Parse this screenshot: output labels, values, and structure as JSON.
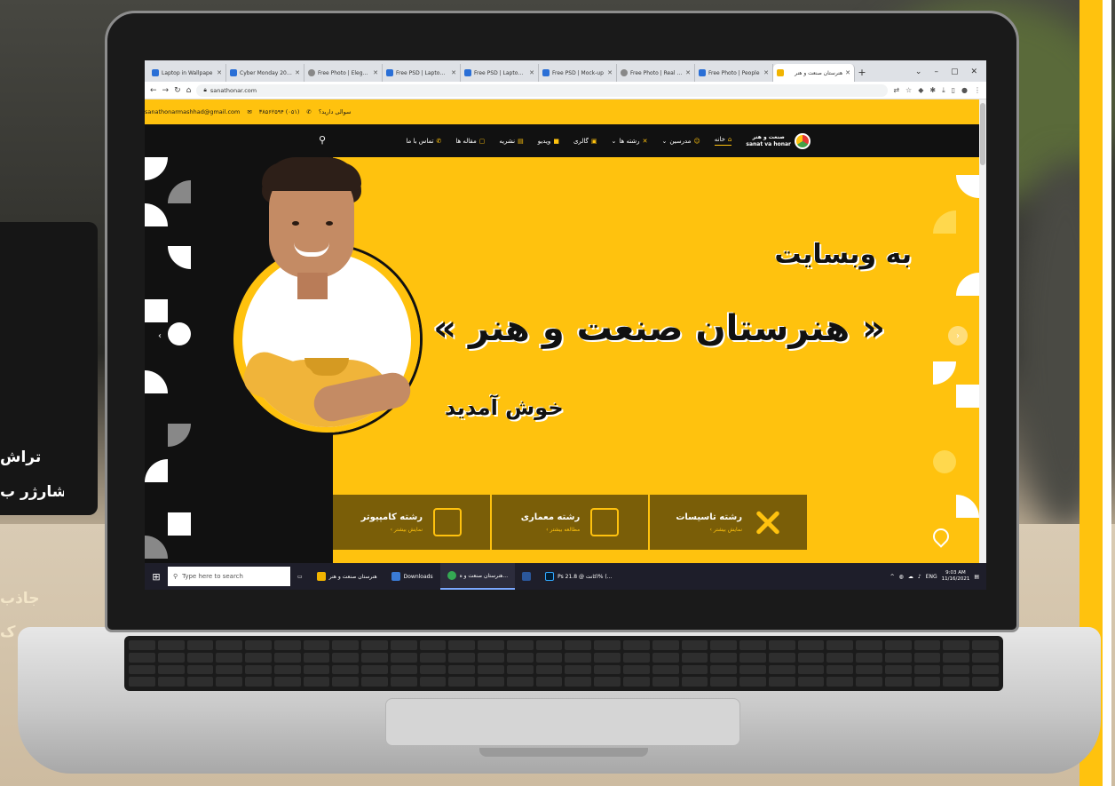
{
  "browser": {
    "tabs": [
      {
        "label": "Laptop in Wallpape",
        "favicon": "bookmark-icon",
        "active": false
      },
      {
        "label": "Cyber Monday 2021",
        "favicon": "bookmark-icon",
        "active": false
      },
      {
        "label": "Free Photo | Elegant",
        "favicon": "globe-icon",
        "active": false
      },
      {
        "label": "Free PSD | Laptop m",
        "favicon": "bookmark-icon",
        "active": false
      },
      {
        "label": "Free PSD | Laptop m",
        "favicon": "bookmark-icon",
        "active": false
      },
      {
        "label": "Free PSD | Mock-up",
        "favicon": "bookmark-icon",
        "active": false
      },
      {
        "label": "Free Photo | Real est",
        "favicon": "globe-icon",
        "active": false
      },
      {
        "label": "Free Photo | People",
        "favicon": "bookmark-icon",
        "active": false
      },
      {
        "label": "هنرستان صنعت و هنر",
        "favicon": "site-icon",
        "active": true
      }
    ],
    "new_tab": "+",
    "url": "sanathonar.com"
  },
  "site": {
    "topbar": {
      "question": "سوالی دارید؟",
      "phone": "(۰۵۱) ۳۸۵۶۲۵۹۴",
      "email": "sanathonarmashhad@gmail.com"
    },
    "logo": {
      "line1": "صنعت و هنر",
      "line2": "sanat va honar"
    },
    "nav": [
      {
        "label": "خانه",
        "icon": "home-icon"
      },
      {
        "label": "مدرسین",
        "icon": "users-icon"
      },
      {
        "label": "رشته ها",
        "icon": "tools-icon"
      },
      {
        "label": "گالری",
        "icon": "image-icon"
      },
      {
        "label": "ویدیو",
        "icon": "video-icon"
      },
      {
        "label": "نشریه",
        "icon": "document-icon"
      },
      {
        "label": "مقاله ها",
        "icon": "article-icon"
      },
      {
        "label": "تماس با ما",
        "icon": "phone-icon"
      }
    ],
    "hero": {
      "line1": "به وبسایت",
      "line2": "« هنرستان صنعت و هنر »",
      "line3": "خوش آمدید"
    },
    "fields": [
      {
        "title": "رشته کامپیوتر",
        "more": "نمایش بیشتر ›",
        "icon": "computer-icon"
      },
      {
        "title": "رشته معماری",
        "more": "مطالعه بیشتر ›",
        "icon": "architecture-icon"
      },
      {
        "title": "رشته تاسیسات",
        "more": "نمایش بیشتر ›",
        "icon": "wrench-icon"
      }
    ]
  },
  "taskbar": {
    "search_placeholder": "Type here to search",
    "items": [
      {
        "label": "هنرستان صنعت و هنر",
        "color": "#f1b400"
      },
      {
        "label": "Downloads",
        "color": "#3a7bd5"
      },
      {
        "label": "هنرستان صنعت و ه...",
        "color": "#34a853"
      },
      {
        "label": "",
        "color": "#2b579a"
      },
      {
        "label": "Ps  اکانت @ 21.8% (...",
        "color": "#31a8ff"
      }
    ],
    "lang": "ENG",
    "time": "9:03 AM",
    "date": "11/16/2021"
  },
  "scene": {
    "side_text": [
      "تراش",
      "شارژر ب",
      "جاذب",
      "ک"
    ],
    "accent": "#ffc20e",
    "dark": "#111111"
  }
}
